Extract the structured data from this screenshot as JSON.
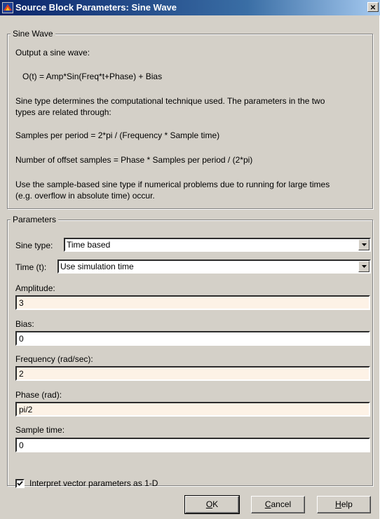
{
  "window": {
    "title": "Source Block Parameters: Sine Wave",
    "close_label": "✕"
  },
  "description": {
    "group_label": "Sine Wave",
    "lines": [
      "Output a sine wave:",
      "O(t) = Amp*Sin(Freq*t+Phase) + Bias",
      "Sine type determines the computational technique used. The parameters in the two",
      "types are related through:",
      "Samples per period = 2*pi / (Frequency * Sample time)",
      "Number of offset samples = Phase * Samples per period / (2*pi)",
      "Use the sample-based sine type if numerical problems due to running for large times",
      "(e.g. overflow in absolute time) occur."
    ]
  },
  "parameters": {
    "group_label": "Parameters",
    "sine_type": {
      "label": "Sine type:",
      "value": "Time based"
    },
    "time": {
      "label": "Time (t):",
      "value": "Use simulation time"
    },
    "amplitude": {
      "label": "Amplitude:",
      "value": "3"
    },
    "bias": {
      "label": "Bias:",
      "value": "0"
    },
    "frequency": {
      "label": "Frequency (rad/sec):",
      "value": "2"
    },
    "phase": {
      "label": "Phase (rad):",
      "value": "pi/2"
    },
    "sample_time": {
      "label": "Sample time:",
      "value": "0"
    },
    "interpret_vector": {
      "label": "Interpret vector parameters as 1-D",
      "checked": true
    }
  },
  "buttons": {
    "ok": {
      "mnemonic": "O",
      "rest": "K"
    },
    "cancel": {
      "mnemonic": "C",
      "rest": "ancel"
    },
    "help": {
      "mnemonic": "H",
      "rest": "elp"
    }
  },
  "colors": {
    "title_gradient_start": "#0a246a",
    "dialog_face": "#d4d0c8",
    "modified_field_bg": "#fdf2e6",
    "default_field_bg": "#ffffff"
  }
}
